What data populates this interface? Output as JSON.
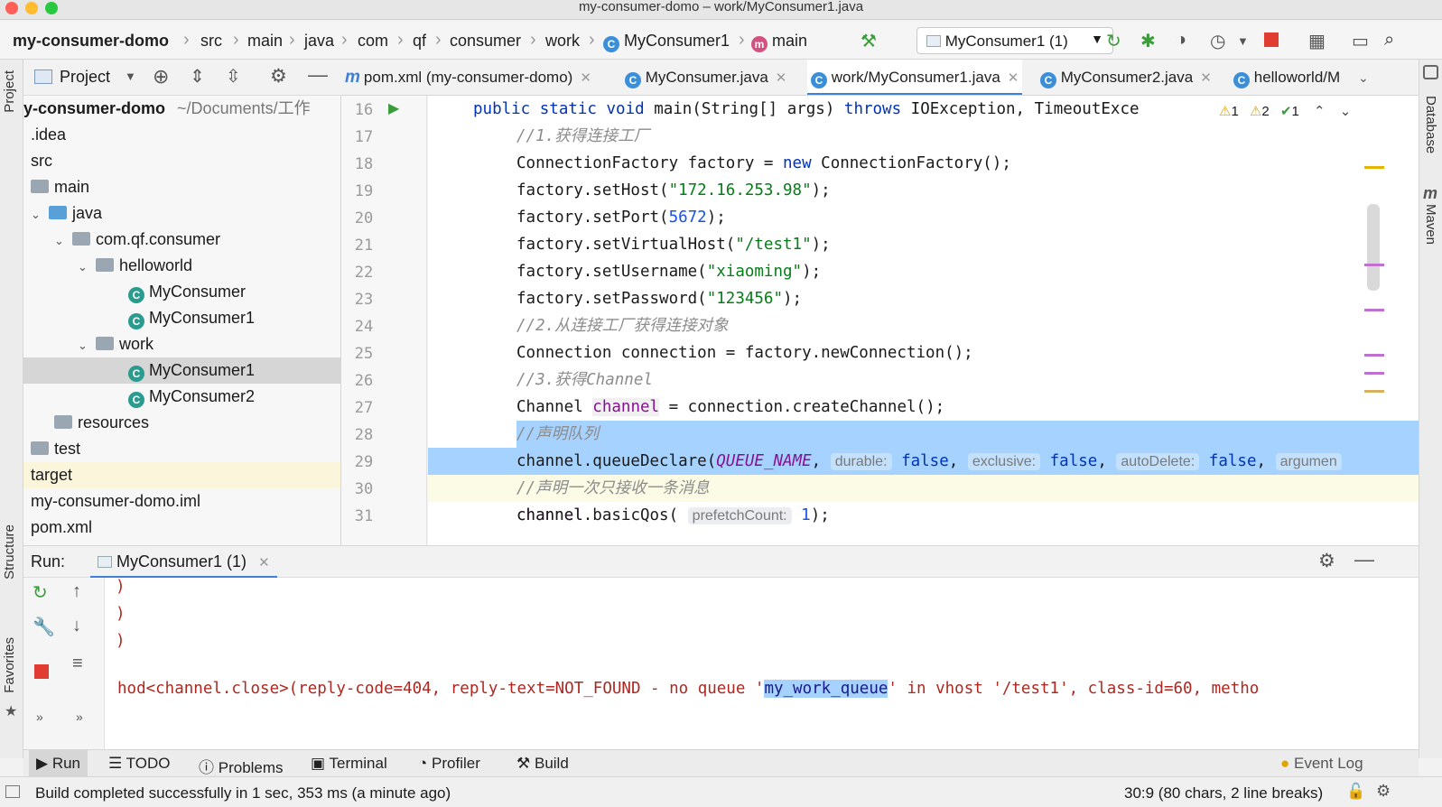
{
  "window": {
    "title": "my-consumer-domo – work/MyConsumer1.java"
  },
  "breadcrumb": [
    "my-consumer-domo",
    "src",
    "main",
    "java",
    "com",
    "qf",
    "consumer",
    "work",
    "MyConsumer1",
    "main"
  ],
  "toolbar": {
    "run_config": "MyConsumer1 (1)"
  },
  "project": {
    "header": "Project",
    "root_name": "y-consumer-domo",
    "root_path": "~/Documents/工作",
    "tree": [
      {
        "label": ".idea"
      },
      {
        "label": "src"
      },
      {
        "label": "main"
      },
      {
        "label": "java"
      },
      {
        "label": "com.qf.consumer"
      },
      {
        "label": "helloworld"
      },
      {
        "label": "MyConsumer"
      },
      {
        "label": "MyConsumer1"
      },
      {
        "label": "work"
      },
      {
        "label": "MyConsumer1"
      },
      {
        "label": "MyConsumer2"
      },
      {
        "label": "resources"
      },
      {
        "label": "test"
      },
      {
        "label": "target"
      },
      {
        "label": "my-consumer-domo.iml"
      },
      {
        "label": "pom.xml"
      }
    ]
  },
  "editor_tabs": [
    {
      "label": "pom.xml (my-consumer-domo)"
    },
    {
      "label": "MyConsumer.java"
    },
    {
      "label": "work/MyConsumer1.java"
    },
    {
      "label": "MyConsumer2.java"
    },
    {
      "label": "helloworld/M"
    }
  ],
  "inspections": {
    "warn1": "1",
    "warn2": "2",
    "ok": "1"
  },
  "code": {
    "line_numbers": [
      "16",
      "17",
      "18",
      "19",
      "20",
      "21",
      "22",
      "23",
      "24",
      "25",
      "26",
      "27",
      "28",
      "29",
      "30",
      "31"
    ],
    "l16": {
      "a": "public static void ",
      "b": "main(String[] args) ",
      "c": "throws",
      "d": " IOException, TimeoutExce"
    },
    "l17": "//1.获得连接工厂",
    "l18": {
      "a": "ConnectionFactory factory = ",
      "b": "new",
      "c": " ConnectionFactory();"
    },
    "l19": {
      "a": "factory.setHost(",
      "b": "\"172.16.253.98\"",
      "c": ");"
    },
    "l20": {
      "a": "factory.setPort(",
      "b": "5672",
      "c": ");"
    },
    "l21": {
      "a": "factory.setVirtualHost(",
      "b": "\"/test1\"",
      "c": ");"
    },
    "l22": {
      "a": "factory.setUsername(",
      "b": "\"xiaoming\"",
      "c": ");"
    },
    "l23": {
      "a": "factory.setPassword(",
      "b": "\"123456\"",
      "c": ");"
    },
    "l24": "//2.从连接工厂获得连接对象",
    "l25": "Connection connection = factory.newConnection();",
    "l26": "//3.获得Channel",
    "l27": {
      "a": "Channel ",
      "b": "channel",
      "c": " = connection.createChannel();"
    },
    "l28": "//声明队列",
    "l29": {
      "a": "channel.queueDeclare(",
      "b": "QUEUE_NAME",
      "c": ", ",
      "h1": "durable:",
      "v1": "false",
      "h2": "exclusive:",
      "v2": "false",
      "h3": "autoDelete:",
      "v3": "false",
      "h4": "argumen"
    },
    "l30": "//声明一次只接收一条消息",
    "l31": {
      "a": "channel.basicQos( ",
      "h": "prefetchCount:",
      "v": "1",
      "c": ");"
    }
  },
  "run_panel": {
    "label": "Run:",
    "tab": "MyConsumer1 (1)",
    "output": [
      ")",
      ")",
      ")"
    ],
    "error_pre": "hod<channel.close>(reply-code=404, reply-text=NOT_FOUND - no queue '",
    "error_sel": "my_work_queue",
    "error_post": "' in vhost '/test1', class-id=60, metho"
  },
  "tool_tabs": [
    "Run",
    "TODO",
    "Problems",
    "Terminal",
    "Profiler",
    "Build"
  ],
  "event_log": "Event Log",
  "status": {
    "message": "Build completed successfully in 1 sec, 353 ms (a minute ago)",
    "position": "30:9 (80 chars, 2 line breaks)"
  },
  "side_labels": {
    "project": "Project",
    "structure": "Structure",
    "favorites": "Favorites",
    "database": "Database",
    "maven": "Maven"
  },
  "colors": {
    "accent": "#3d80d9",
    "selection": "#a6d2ff",
    "error_text": "#b0271f"
  }
}
